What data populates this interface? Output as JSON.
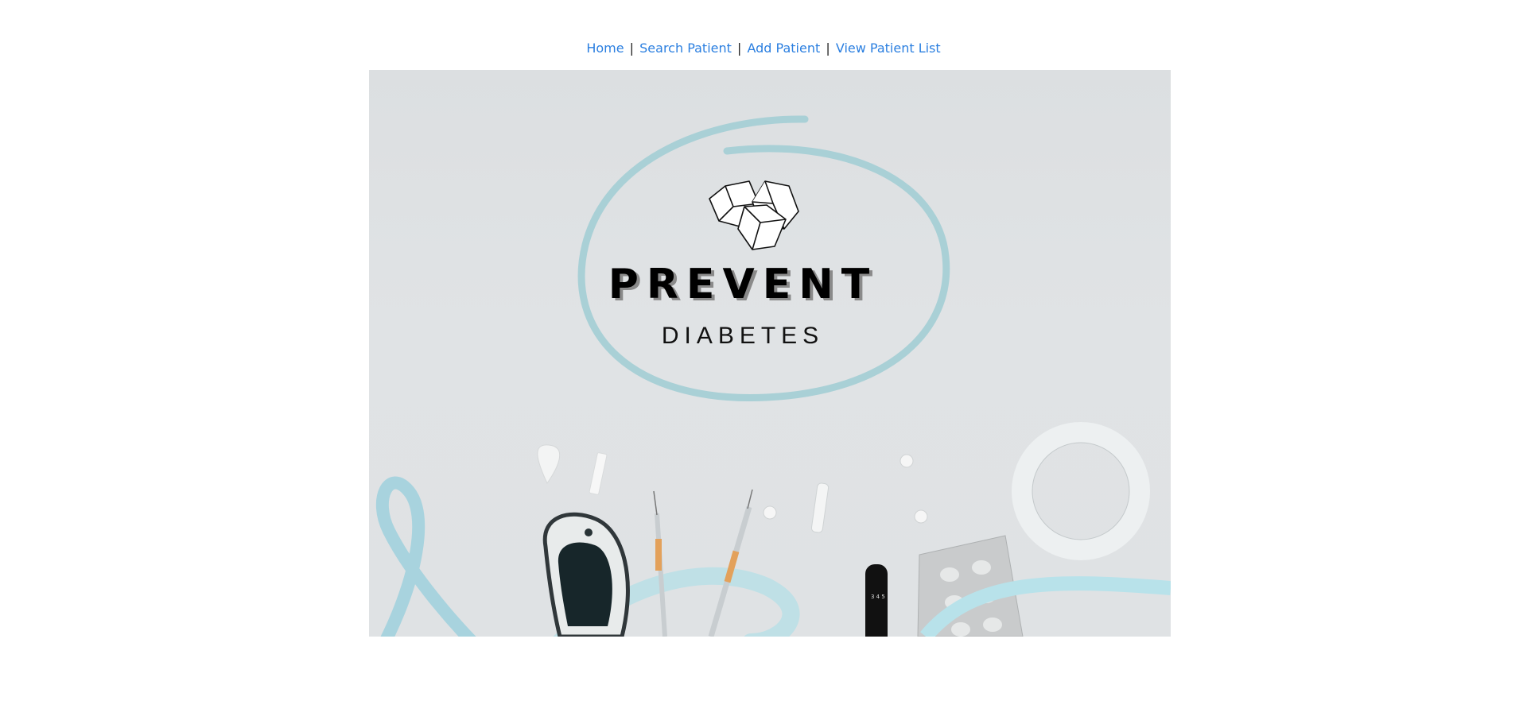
{
  "nav": {
    "home": "Home",
    "search_patient": "Search Patient",
    "add_patient": "Add Patient",
    "view_patient_list": "View Patient List",
    "separator": "|"
  },
  "hero": {
    "title_line1": "PREVENT",
    "title_line2": "DIABETES"
  },
  "colors": {
    "link": "#2b7fe0",
    "hero_background": "#dfe2e4",
    "ring_accent": "#a9d0d6"
  },
  "icons": [
    "sugar-cubes-icon",
    "awareness-ribbon-icon",
    "glucometer-icon",
    "syringe-icon",
    "lancet-icon",
    "pill-blister-icon"
  ]
}
